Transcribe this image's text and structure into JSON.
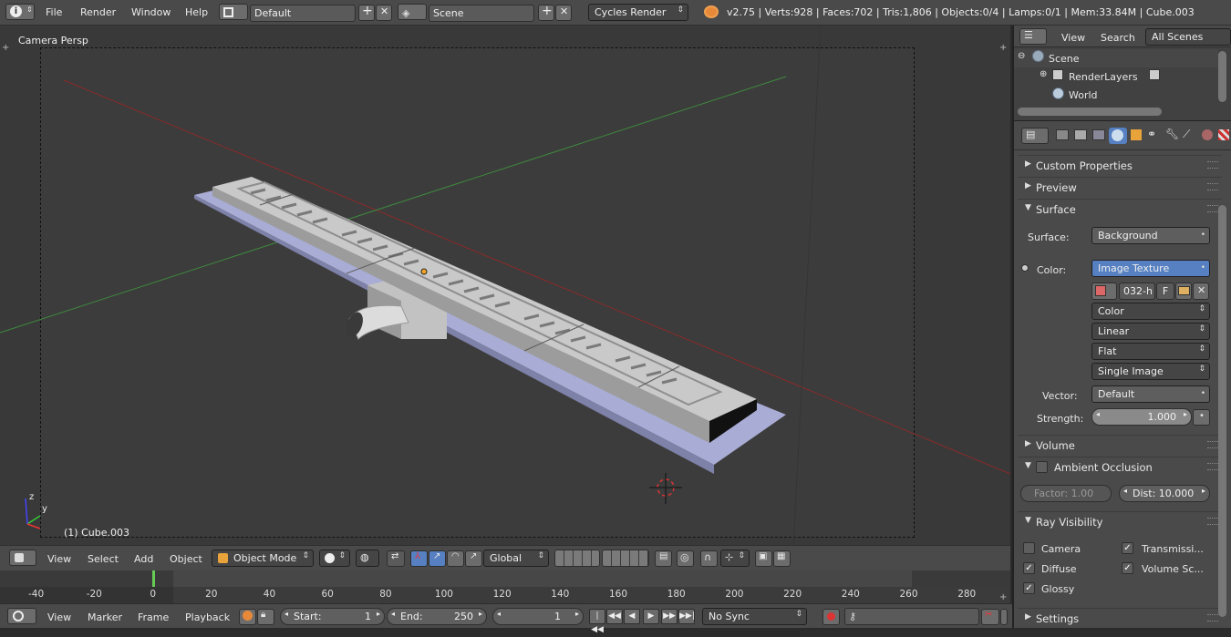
{
  "topbar": {
    "menus": [
      "File",
      "Render",
      "Window",
      "Help"
    ],
    "screen_layout": "Default",
    "scene": "Scene",
    "render_engine": "Cycles Render",
    "stats": "v2.75 | Verts:928 | Faces:702 | Tris:1,806 | Objects:0/4 | Lamps:0/1 | Mem:33.84M | Cube.003"
  },
  "viewport": {
    "view_label": "Camera Persp",
    "object_label": "(1) Cube.003",
    "axis_y": "y",
    "axis_z": "z"
  },
  "view3d_header": {
    "menus": [
      "View",
      "Select",
      "Add",
      "Object"
    ],
    "mode": "Object Mode",
    "orientation": "Global"
  },
  "timeline": {
    "ticks": [
      "-40",
      "-20",
      "0",
      "20",
      "40",
      "60",
      "80",
      "100",
      "120",
      "140",
      "160",
      "180",
      "200",
      "220",
      "240",
      "260",
      "280"
    ],
    "menus": [
      "View",
      "Marker",
      "Frame",
      "Playback"
    ],
    "start_label": "Start:",
    "start": "1",
    "end_label": "End:",
    "end": "250",
    "current_frame": "1",
    "sync": "No Sync",
    "current_frame_pos": 0.0
  },
  "outliner": {
    "menus": [
      "View",
      "Search"
    ],
    "filter": "All Scenes",
    "items": [
      "Scene",
      "RenderLayers",
      "World"
    ]
  },
  "properties": {
    "panels_collapsed_top": [
      "Custom Properties",
      "Preview"
    ],
    "surface_panel": "Surface",
    "surface_label": "Surface:",
    "surface_value": "Background",
    "color_label": "Color:",
    "color_value": "Image Texture",
    "image_name": "032-h",
    "image_fake": "F",
    "color_space": "Color",
    "interpolation": "Linear",
    "projection": "Flat",
    "source": "Single Image",
    "vector_label": "Vector:",
    "vector_value": "Default",
    "strength_label": "Strength:",
    "strength_value": "1.000",
    "volume_panel": "Volume",
    "ao_panel": "Ambient Occlusion",
    "ao_factor": "Factor:  1.00",
    "ao_dist": "Dist:  10.000",
    "ray_panel": "Ray Visibility",
    "ray": [
      {
        "label": "Camera",
        "checked": false
      },
      {
        "label": "Transmissi...",
        "checked": true
      },
      {
        "label": "Diffuse",
        "checked": true
      },
      {
        "label": "Volume Sc...",
        "checked": true
      },
      {
        "label": "Glossy",
        "checked": true
      }
    ],
    "settings_panel": "Settings"
  },
  "colors": {
    "accent_blue": "#5680c2",
    "frame_green": "#66cc55"
  }
}
